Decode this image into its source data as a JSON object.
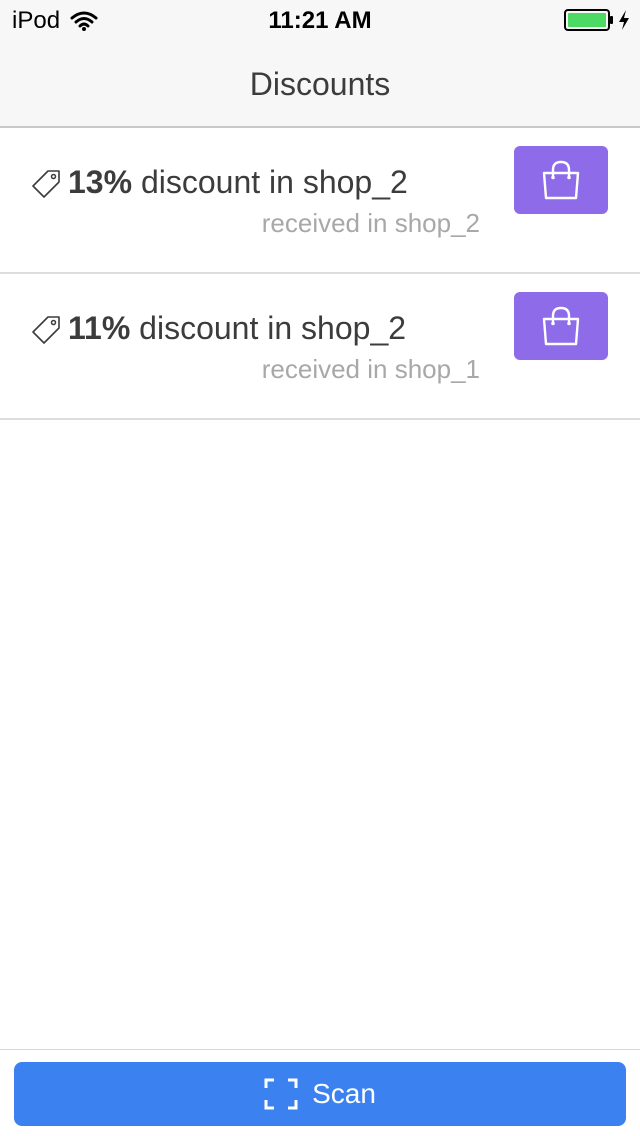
{
  "status_bar": {
    "carrier": "iPod",
    "time": "11:21 AM",
    "icons": [
      "wifi-icon",
      "battery-icon",
      "charging-icon"
    ],
    "battery_color": "#4cd964"
  },
  "nav": {
    "title": "Discounts"
  },
  "discounts": [
    {
      "percent": "13%",
      "text": " discount in shop_2",
      "received": "received in shop_2",
      "icon": "tag-icon",
      "action_icon": "shopping-bag-icon"
    },
    {
      "percent": "11%",
      "text": " discount in shop_2",
      "received": "received in shop_1",
      "icon": "tag-icon",
      "action_icon": "shopping-bag-icon"
    }
  ],
  "bottom": {
    "scan_label": "Scan",
    "scan_icon": "scan-icon"
  },
  "colors": {
    "accent_purple": "#8e6be8",
    "accent_blue": "#3b82f0"
  }
}
